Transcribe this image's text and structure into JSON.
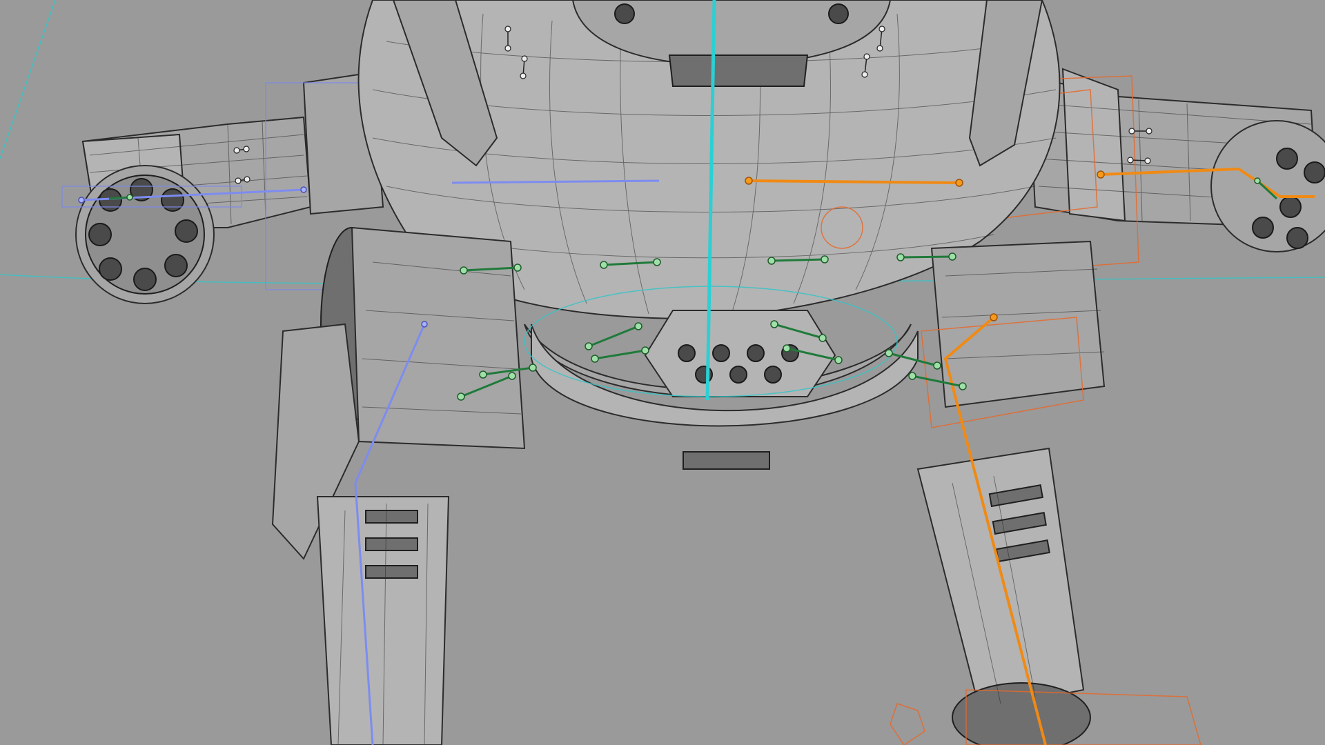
{
  "viewport": {
    "background": "#9a9a9a",
    "mode": "wireframe-on-shaded",
    "subject": "mech-robot-rig"
  },
  "colors": {
    "left_chain": "#7d8cf0",
    "right_chain": "#f08a14",
    "center_spine": "#2ad0d4",
    "control_joints": "#1f7a3a",
    "right_cages": "#e6692a"
  }
}
